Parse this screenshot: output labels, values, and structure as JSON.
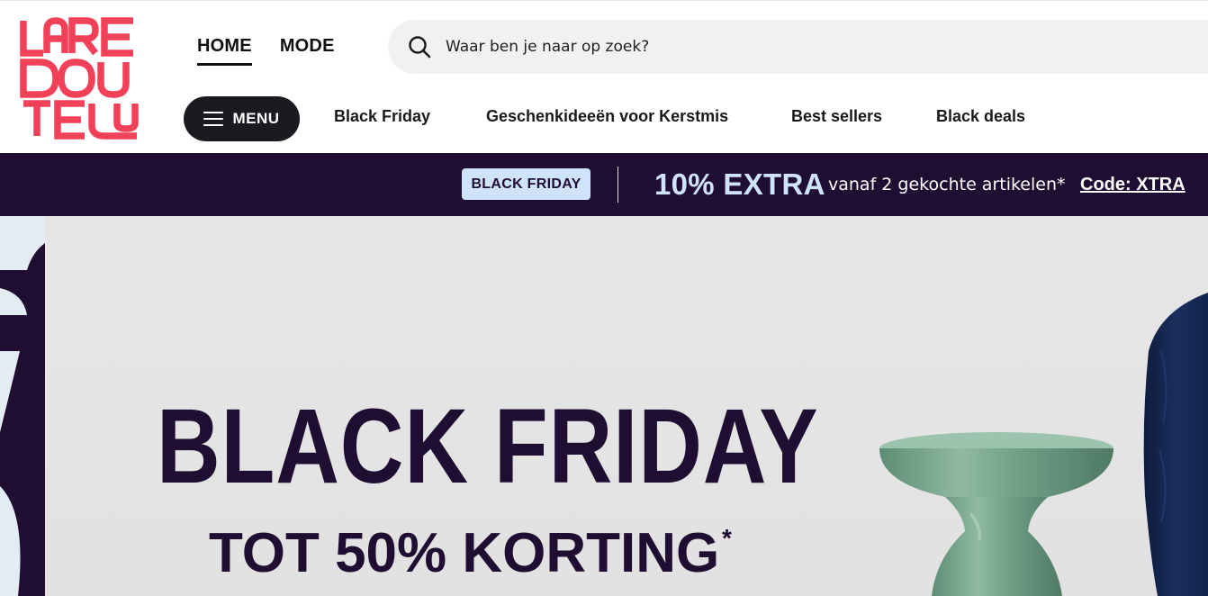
{
  "brand": {
    "logo_text": "LA REDOUTE",
    "logo_color": "#f14158"
  },
  "primary_nav": [
    {
      "label": "HOME",
      "active": true
    },
    {
      "label": "MODE",
      "active": false
    }
  ],
  "search": {
    "placeholder": "Waar ben je naar op zoek?",
    "value": ""
  },
  "menu_button": {
    "label": "MENU"
  },
  "secondary_nav": [
    {
      "label": "Black Friday"
    },
    {
      "label": "Geschenkideeën voor Kerstmis"
    },
    {
      "label": "Best sellers"
    },
    {
      "label": "Black deals"
    }
  ],
  "promo_bar": {
    "badge": "BLACK FRIDAY",
    "extra": "10% EXTRA",
    "text": "vanaf 2 gekochte artikelen*",
    "code": "Code: XTRA"
  },
  "hero": {
    "title": "BLACK FRIDAY",
    "subtitle": "TOT 50% KORTING",
    "asterisk": "*"
  },
  "colors": {
    "promo_bg": "#1f0e32",
    "badge_bg": "#cfe3fb",
    "menu_button_bg": "#1c1a20",
    "search_bg": "#f1f1f1",
    "stool": "#6f9e86",
    "sofa": "#13254e"
  }
}
